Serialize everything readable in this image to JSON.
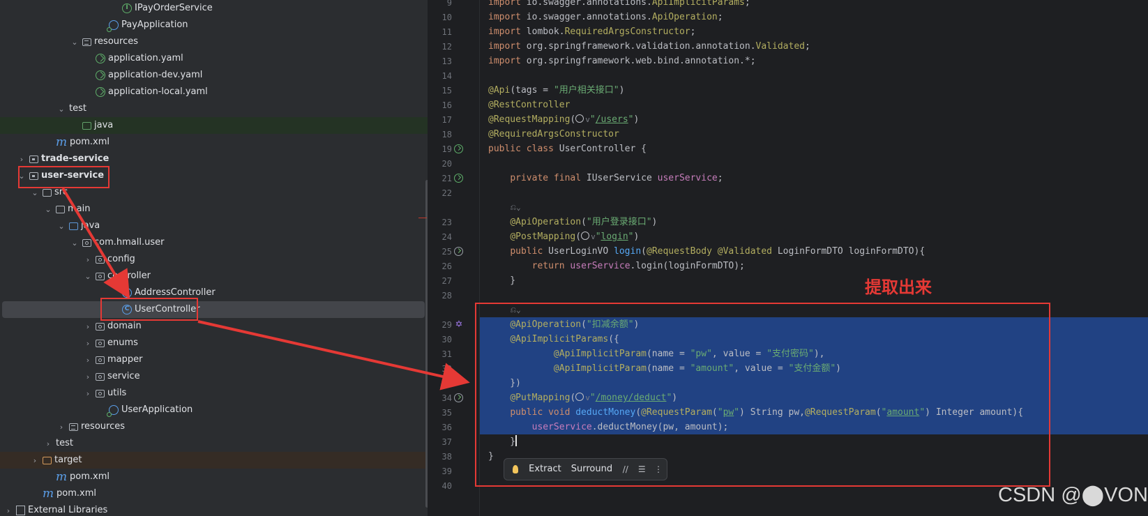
{
  "project_tree": {
    "rows": [
      {
        "label": "IPayOrderService",
        "icon": "interface-icon",
        "depth": 8,
        "chevron": "none"
      },
      {
        "label": "PayApplication",
        "icon": "spring-class-icon",
        "depth": 7,
        "chevron": "none"
      },
      {
        "label": "resources",
        "icon": "resources-folder-icon",
        "depth": 5,
        "chevron": "expanded"
      },
      {
        "label": "application.yaml",
        "icon": "yaml-icon",
        "depth": 6,
        "chevron": "none"
      },
      {
        "label": "application-dev.yaml",
        "icon": "yaml-icon",
        "depth": 6,
        "chevron": "none"
      },
      {
        "label": "application-local.yaml",
        "icon": "yaml-icon",
        "depth": 6,
        "chevron": "none"
      },
      {
        "label": "test",
        "icon": "none",
        "depth": 4,
        "chevron": "expanded"
      },
      {
        "label": "java",
        "icon": "test-folder-icon",
        "depth": 5,
        "chevron": "none"
      },
      {
        "label": "pom.xml",
        "icon": "maven-icon",
        "depth": 3,
        "chevron": "none"
      },
      {
        "label": "trade-service",
        "icon": "module-folder-icon",
        "depth": 1,
        "chevron": "collapsed",
        "bold": true
      },
      {
        "label": "user-service",
        "icon": "module-folder-icon",
        "depth": 1,
        "chevron": "expanded",
        "bold": true
      },
      {
        "label": "src",
        "icon": "folder-icon",
        "depth": 2,
        "chevron": "expanded"
      },
      {
        "label": "main",
        "icon": "folder-icon",
        "depth": 3,
        "chevron": "expanded"
      },
      {
        "label": "java",
        "icon": "source-folder-icon",
        "depth": 4,
        "chevron": "expanded"
      },
      {
        "label": "com.hmall.user",
        "icon": "package-icon",
        "depth": 5,
        "chevron": "expanded"
      },
      {
        "label": "config",
        "icon": "package-icon",
        "depth": 6,
        "chevron": "collapsed"
      },
      {
        "label": "controller",
        "icon": "package-icon",
        "depth": 6,
        "chevron": "expanded"
      },
      {
        "label": "AddressController",
        "icon": "class-icon",
        "depth": 8,
        "chevron": "none"
      },
      {
        "label": "UserController",
        "icon": "class-icon",
        "depth": 8,
        "chevron": "none"
      },
      {
        "label": "domain",
        "icon": "package-icon",
        "depth": 6,
        "chevron": "collapsed"
      },
      {
        "label": "enums",
        "icon": "package-icon",
        "depth": 6,
        "chevron": "collapsed"
      },
      {
        "label": "mapper",
        "icon": "package-icon",
        "depth": 6,
        "chevron": "collapsed"
      },
      {
        "label": "service",
        "icon": "package-icon",
        "depth": 6,
        "chevron": "collapsed"
      },
      {
        "label": "utils",
        "icon": "package-icon",
        "depth": 6,
        "chevron": "collapsed"
      },
      {
        "label": "UserApplication",
        "icon": "spring-class-icon",
        "depth": 7,
        "chevron": "none"
      },
      {
        "label": "resources",
        "icon": "resources-folder-icon",
        "depth": 4,
        "chevron": "collapsed"
      },
      {
        "label": "test",
        "icon": "none",
        "depth": 3,
        "chevron": "collapsed"
      },
      {
        "label": "target",
        "icon": "target-folder-icon",
        "depth": 2,
        "chevron": "collapsed"
      },
      {
        "label": "pom.xml",
        "icon": "maven-icon",
        "depth": 3,
        "chevron": "none"
      },
      {
        "label": "pom.xml",
        "icon": "maven-icon",
        "depth": 2,
        "chevron": "none"
      },
      {
        "label": "External Libraries",
        "icon": "libraries-icon",
        "depth": 0,
        "chevron": "collapsed"
      }
    ]
  },
  "editor": {
    "lines": [
      {
        "n": "9",
        "tokens": [
          [
            "kw",
            "import "
          ],
          [
            "p",
            "io.swagger.annotations."
          ],
          [
            "an",
            "ApiImplicitParams"
          ],
          [
            "p",
            ";"
          ]
        ]
      },
      {
        "n": "10",
        "tokens": [
          [
            "kw",
            "import "
          ],
          [
            "p",
            "io.swagger.annotations."
          ],
          [
            "an",
            "ApiOperation"
          ],
          [
            "p",
            ";"
          ]
        ]
      },
      {
        "n": "11",
        "tokens": [
          [
            "kw",
            "import "
          ],
          [
            "p",
            "lombok."
          ],
          [
            "an",
            "RequiredArgsConstructor"
          ],
          [
            "p",
            ";"
          ]
        ]
      },
      {
        "n": "12",
        "tokens": [
          [
            "kw",
            "import "
          ],
          [
            "p",
            "org.springframework.validation.annotation."
          ],
          [
            "an",
            "Validated"
          ],
          [
            "p",
            ";"
          ]
        ]
      },
      {
        "n": "13",
        "tokens": [
          [
            "kw",
            "import "
          ],
          [
            "p",
            "org.springframework.web.bind.annotation.*;"
          ]
        ]
      },
      {
        "n": "14",
        "tokens": []
      },
      {
        "n": "15",
        "tokens": [
          [
            "an",
            "@Api"
          ],
          [
            "p",
            "(tags = "
          ],
          [
            "st",
            "\"用户相关接口\""
          ],
          [
            "p",
            ")"
          ]
        ]
      },
      {
        "n": "16",
        "tokens": [
          [
            "an",
            "@RestController"
          ]
        ]
      },
      {
        "n": "17",
        "tokens": [
          [
            "an",
            "@RequestMapping"
          ],
          [
            "p",
            "("
          ],
          [
            "glob",
            ""
          ],
          [
            "hint",
            "v"
          ],
          [
            "st",
            "\""
          ],
          [
            "url",
            "/users"
          ],
          [
            "st",
            "\""
          ],
          [
            "p",
            ")"
          ]
        ]
      },
      {
        "n": "18",
        "tokens": [
          [
            "an",
            "@RequiredArgsConstructor"
          ]
        ]
      },
      {
        "n": "19",
        "tokens": [
          [
            "kw",
            "public class "
          ],
          [
            "p",
            "UserController {"
          ]
        ]
      },
      {
        "n": "20",
        "tokens": []
      },
      {
        "n": "21",
        "tokens": [
          [
            "p",
            "    "
          ],
          [
            "kw",
            "private final "
          ],
          [
            "p",
            "IUserService "
          ],
          [
            "fld",
            "userService"
          ],
          [
            "p",
            ";"
          ]
        ]
      },
      {
        "n": "22",
        "tokens": []
      },
      {
        "n": "",
        "tokens": [
          [
            "p",
            "    "
          ],
          [
            "hint",
            "⎌⌄"
          ]
        ]
      },
      {
        "n": "23",
        "tokens": [
          [
            "p",
            "    "
          ],
          [
            "an",
            "@ApiOperation"
          ],
          [
            "p",
            "("
          ],
          [
            "st",
            "\"用户登录接口\""
          ],
          [
            "p",
            ")"
          ]
        ]
      },
      {
        "n": "24",
        "tokens": [
          [
            "p",
            "    "
          ],
          [
            "an",
            "@PostMapping"
          ],
          [
            "p",
            "("
          ],
          [
            "glob",
            ""
          ],
          [
            "hint",
            "v"
          ],
          [
            "st",
            "\""
          ],
          [
            "url",
            "login"
          ],
          [
            "st",
            "\""
          ],
          [
            "p",
            ")"
          ]
        ]
      },
      {
        "n": "25",
        "tokens": [
          [
            "p",
            "    "
          ],
          [
            "kw",
            "public "
          ],
          [
            "p",
            "UserLoginVO "
          ],
          [
            "fn",
            "login"
          ],
          [
            "p",
            "("
          ],
          [
            "an",
            "@RequestBody @Validated "
          ],
          [
            "p",
            "LoginFormDTO loginFormDTO){"
          ]
        ]
      },
      {
        "n": "26",
        "tokens": [
          [
            "p",
            "        "
          ],
          [
            "kw",
            "return "
          ],
          [
            "fld",
            "userService"
          ],
          [
            "p",
            ".login(loginFormDTO);"
          ]
        ]
      },
      {
        "n": "27",
        "tokens": [
          [
            "p",
            "    }"
          ]
        ]
      },
      {
        "n": "28",
        "tokens": []
      },
      {
        "n": "",
        "tokens": [
          [
            "p",
            "    "
          ],
          [
            "hint",
            "⎌⌄"
          ]
        ]
      },
      {
        "n": "29",
        "tokens": [
          [
            "p",
            "    "
          ],
          [
            "an",
            "@ApiOperation"
          ],
          [
            "p",
            "("
          ],
          [
            "st",
            "\"扣减余额\""
          ],
          [
            "p",
            ")"
          ]
        ]
      },
      {
        "n": "30",
        "tokens": [
          [
            "p",
            "    "
          ],
          [
            "an",
            "@ApiImplicitParams"
          ],
          [
            "p",
            "({"
          ]
        ]
      },
      {
        "n": "31",
        "tokens": [
          [
            "p",
            "            "
          ],
          [
            "an",
            "@ApiImplicitParam"
          ],
          [
            "p",
            "(name = "
          ],
          [
            "st",
            "\"pw\""
          ],
          [
            "p",
            ", value = "
          ],
          [
            "st",
            "\"支付密码\""
          ],
          [
            "p",
            "),"
          ]
        ]
      },
      {
        "n": "32",
        "tokens": [
          [
            "p",
            "            "
          ],
          [
            "an",
            "@ApiImplicitParam"
          ],
          [
            "p",
            "(name = "
          ],
          [
            "st",
            "\"amount\""
          ],
          [
            "p",
            ", value = "
          ],
          [
            "st",
            "\"支付金额\""
          ],
          [
            "p",
            ")"
          ]
        ]
      },
      {
        "n": "33",
        "tokens": [
          [
            "p",
            "    })"
          ]
        ]
      },
      {
        "n": "34",
        "tokens": [
          [
            "p",
            "    "
          ],
          [
            "an",
            "@PutMapping"
          ],
          [
            "p",
            "("
          ],
          [
            "glob",
            ""
          ],
          [
            "hint",
            "v"
          ],
          [
            "st",
            "\""
          ],
          [
            "url",
            "/money/deduct"
          ],
          [
            "st",
            "\""
          ],
          [
            "p",
            ")"
          ]
        ]
      },
      {
        "n": "35",
        "tokens": [
          [
            "p",
            "    "
          ],
          [
            "kw",
            "public void "
          ],
          [
            "fn",
            "deductMoney"
          ],
          [
            "p",
            "("
          ],
          [
            "an",
            "@RequestParam"
          ],
          [
            "p",
            "("
          ],
          [
            "st",
            "\""
          ],
          [
            "url",
            "pw"
          ],
          [
            "st",
            "\""
          ],
          [
            "p",
            ") String pw,"
          ],
          [
            "an",
            "@RequestParam"
          ],
          [
            "p",
            "("
          ],
          [
            "st",
            "\""
          ],
          [
            "url",
            "amount"
          ],
          [
            "st",
            "\""
          ],
          [
            "p",
            ") Integer amount){"
          ]
        ]
      },
      {
        "n": "36",
        "tokens": [
          [
            "p",
            "        "
          ],
          [
            "fld",
            "userService"
          ],
          [
            "p",
            ".deductMoney(pw, amount);"
          ]
        ]
      },
      {
        "n": "37",
        "tokens": [
          [
            "p",
            "    }"
          ],
          [
            "caret",
            ""
          ]
        ]
      },
      {
        "n": "38",
        "tokens": [
          [
            "p",
            "}"
          ]
        ]
      },
      {
        "n": "39",
        "tokens": []
      },
      {
        "n": "40",
        "tokens": []
      }
    ]
  },
  "popup": {
    "extract": "Extract",
    "surround": "Surround"
  },
  "annotation": {
    "label": "提取出来"
  },
  "watermark": "CSDN @⬤VON",
  "colors": {
    "selection": "#214283",
    "annotation_red": "#e53935"
  }
}
